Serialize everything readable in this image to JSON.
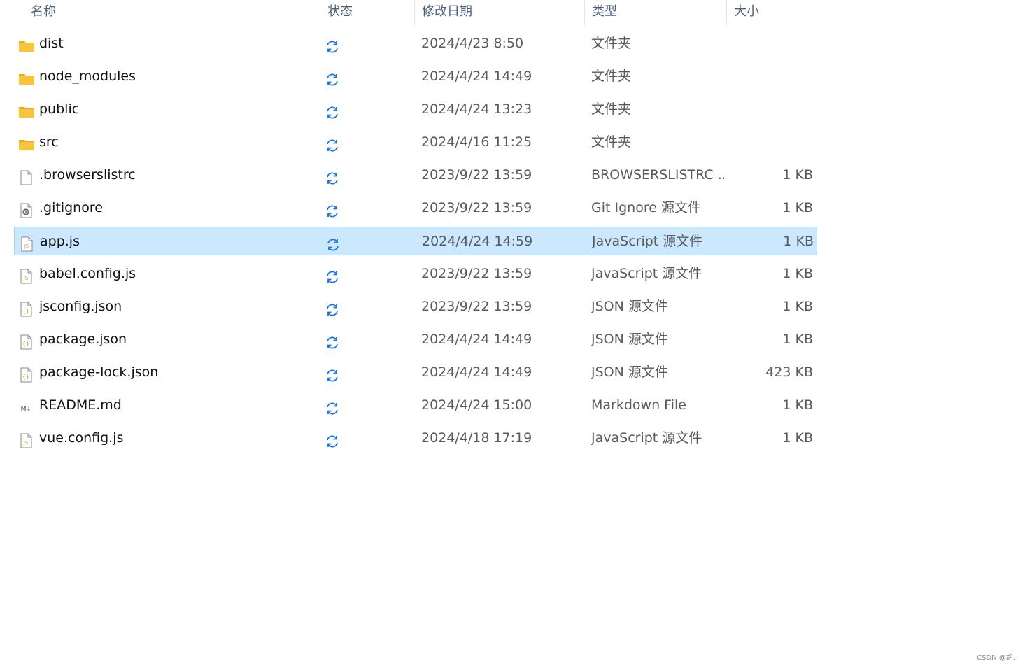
{
  "header": {
    "name_label": "名称",
    "status_label": "状态",
    "date_label": "修改日期",
    "type_label": "类型",
    "size_label": "大小",
    "sort_indicator": "^"
  },
  "files": [
    {
      "name": "dist",
      "icon": "folder-icon",
      "status": "sync-pending-icon",
      "date": "2024/4/23 8:50",
      "type": "文件夹",
      "size": ""
    },
    {
      "name": "node_modules",
      "icon": "folder-icon",
      "status": "sync-pending-icon",
      "date": "2024/4/24 14:49",
      "type": "文件夹",
      "size": ""
    },
    {
      "name": "public",
      "icon": "folder-icon",
      "status": "sync-pending-icon",
      "date": "2024/4/24 13:23",
      "type": "文件夹",
      "size": ""
    },
    {
      "name": "src",
      "icon": "folder-icon",
      "status": "sync-pending-icon",
      "date": "2024/4/16 11:25",
      "type": "文件夹",
      "size": ""
    },
    {
      "name": ".browserslistrc",
      "icon": "blank-file-icon",
      "status": "sync-pending-icon",
      "date": "2023/9/22 13:59",
      "type": "BROWSERSLISTRC ...",
      "size": "1 KB"
    },
    {
      "name": ".gitignore",
      "icon": "settings-file-icon",
      "status": "sync-pending-icon",
      "date": "2023/9/22 13:59",
      "type": "Git Ignore 源文件",
      "size": "1 KB"
    },
    {
      "name": "app.js",
      "icon": "js-file-icon",
      "status": "sync-pending-icon",
      "date": "2024/4/24 14:59",
      "type": "JavaScript 源文件",
      "size": "1 KB",
      "selected": true
    },
    {
      "name": "babel.config.js",
      "icon": "js-file-icon",
      "status": "sync-pending-icon",
      "date": "2023/9/22 13:59",
      "type": "JavaScript 源文件",
      "size": "1 KB"
    },
    {
      "name": "jsconfig.json",
      "icon": "json-file-icon",
      "status": "sync-pending-icon",
      "date": "2023/9/22 13:59",
      "type": "JSON 源文件",
      "size": "1 KB"
    },
    {
      "name": "package.json",
      "icon": "json-file-icon",
      "status": "sync-pending-icon",
      "date": "2024/4/24 14:49",
      "type": "JSON 源文件",
      "size": "1 KB"
    },
    {
      "name": "package-lock.json",
      "icon": "json-file-icon",
      "status": "sync-pending-icon",
      "date": "2024/4/24 14:49",
      "type": "JSON 源文件",
      "size": "423 KB"
    },
    {
      "name": "README.md",
      "icon": "markdown-file-icon",
      "status": "sync-pending-icon",
      "date": "2024/4/24 15:00",
      "type": "Markdown File",
      "size": "1 KB"
    },
    {
      "name": "vue.config.js",
      "icon": "js-file-icon",
      "status": "sync-pending-icon",
      "date": "2024/4/18 17:19",
      "type": "JavaScript 源文件",
      "size": "1 KB"
    }
  ],
  "colors": {
    "folder": "#f8c43c",
    "folder_dark": "#e8ab1e",
    "sync": "#1a73d9",
    "selection_bg": "#cce8ff",
    "selection_border": "#99d1ff",
    "js_label": "#c9a227"
  },
  "watermark": "CSDN @胡."
}
